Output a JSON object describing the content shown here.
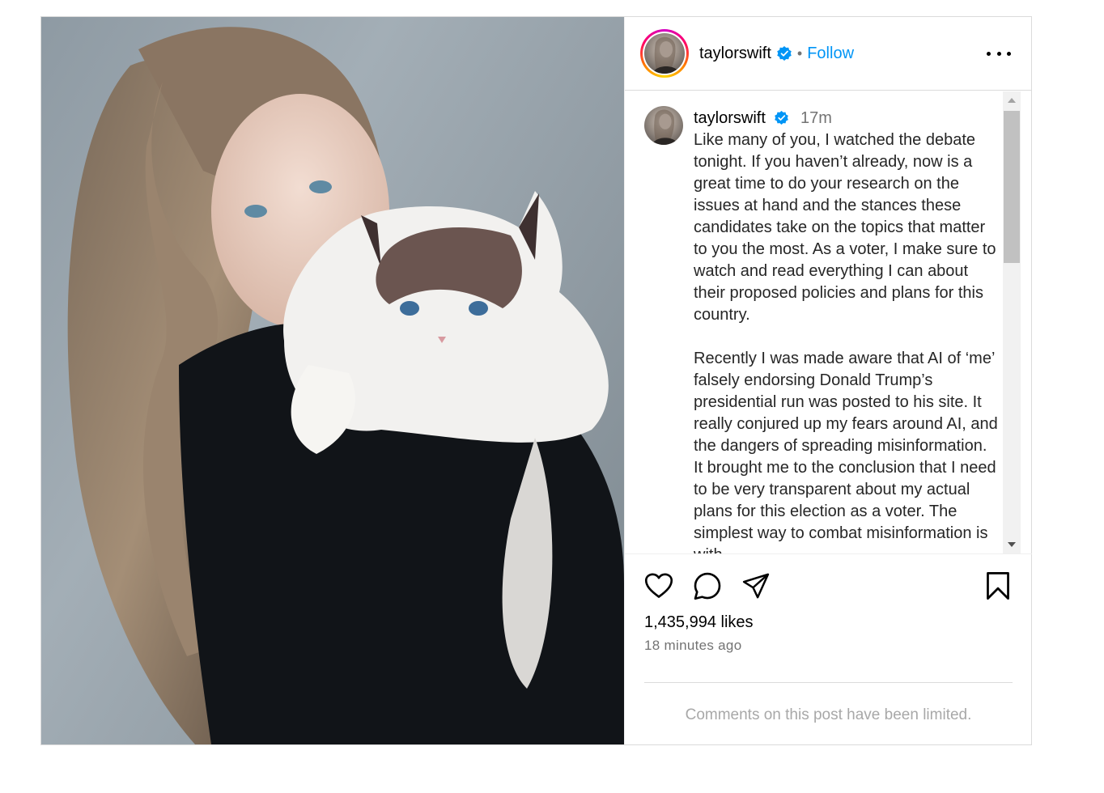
{
  "header": {
    "username": "taylorswift",
    "separator": "•",
    "follow_label": "Follow"
  },
  "caption": {
    "username": "taylorswift",
    "time": "17m",
    "paragraphs": [
      "Like many of you, I watched the debate tonight. If you haven’t already, now is a great time to do your research on the issues at hand and the stances these candidates take on the topics that matter to you the most. As a voter, I make sure to watch and read everything I can about their proposed policies and plans for this country.",
      "Recently I was made aware that AI of ‘me’ falsely endorsing Donald Trump’s presidential run was posted to his site. It really conjured up my fears around AI, and the dangers of spreading misinformation. It brought me to the conclusion that I need to be very transparent about my actual plans for this election as a voter. The simplest way to combat misinformation is with"
    ]
  },
  "actions": {
    "like_icon": "heart-icon",
    "comment_icon": "comment-icon",
    "share_icon": "send-icon",
    "save_icon": "bookmark-icon"
  },
  "likes_text": "1,435,994 likes",
  "time_ago": "18 minutes ago",
  "comments_limited": "Comments on this post have been limited.",
  "colors": {
    "follow_blue": "#0095f6",
    "verified_blue": "#0095f6",
    "secondary_text": "#737373",
    "limited_text": "#a8a8a8"
  }
}
